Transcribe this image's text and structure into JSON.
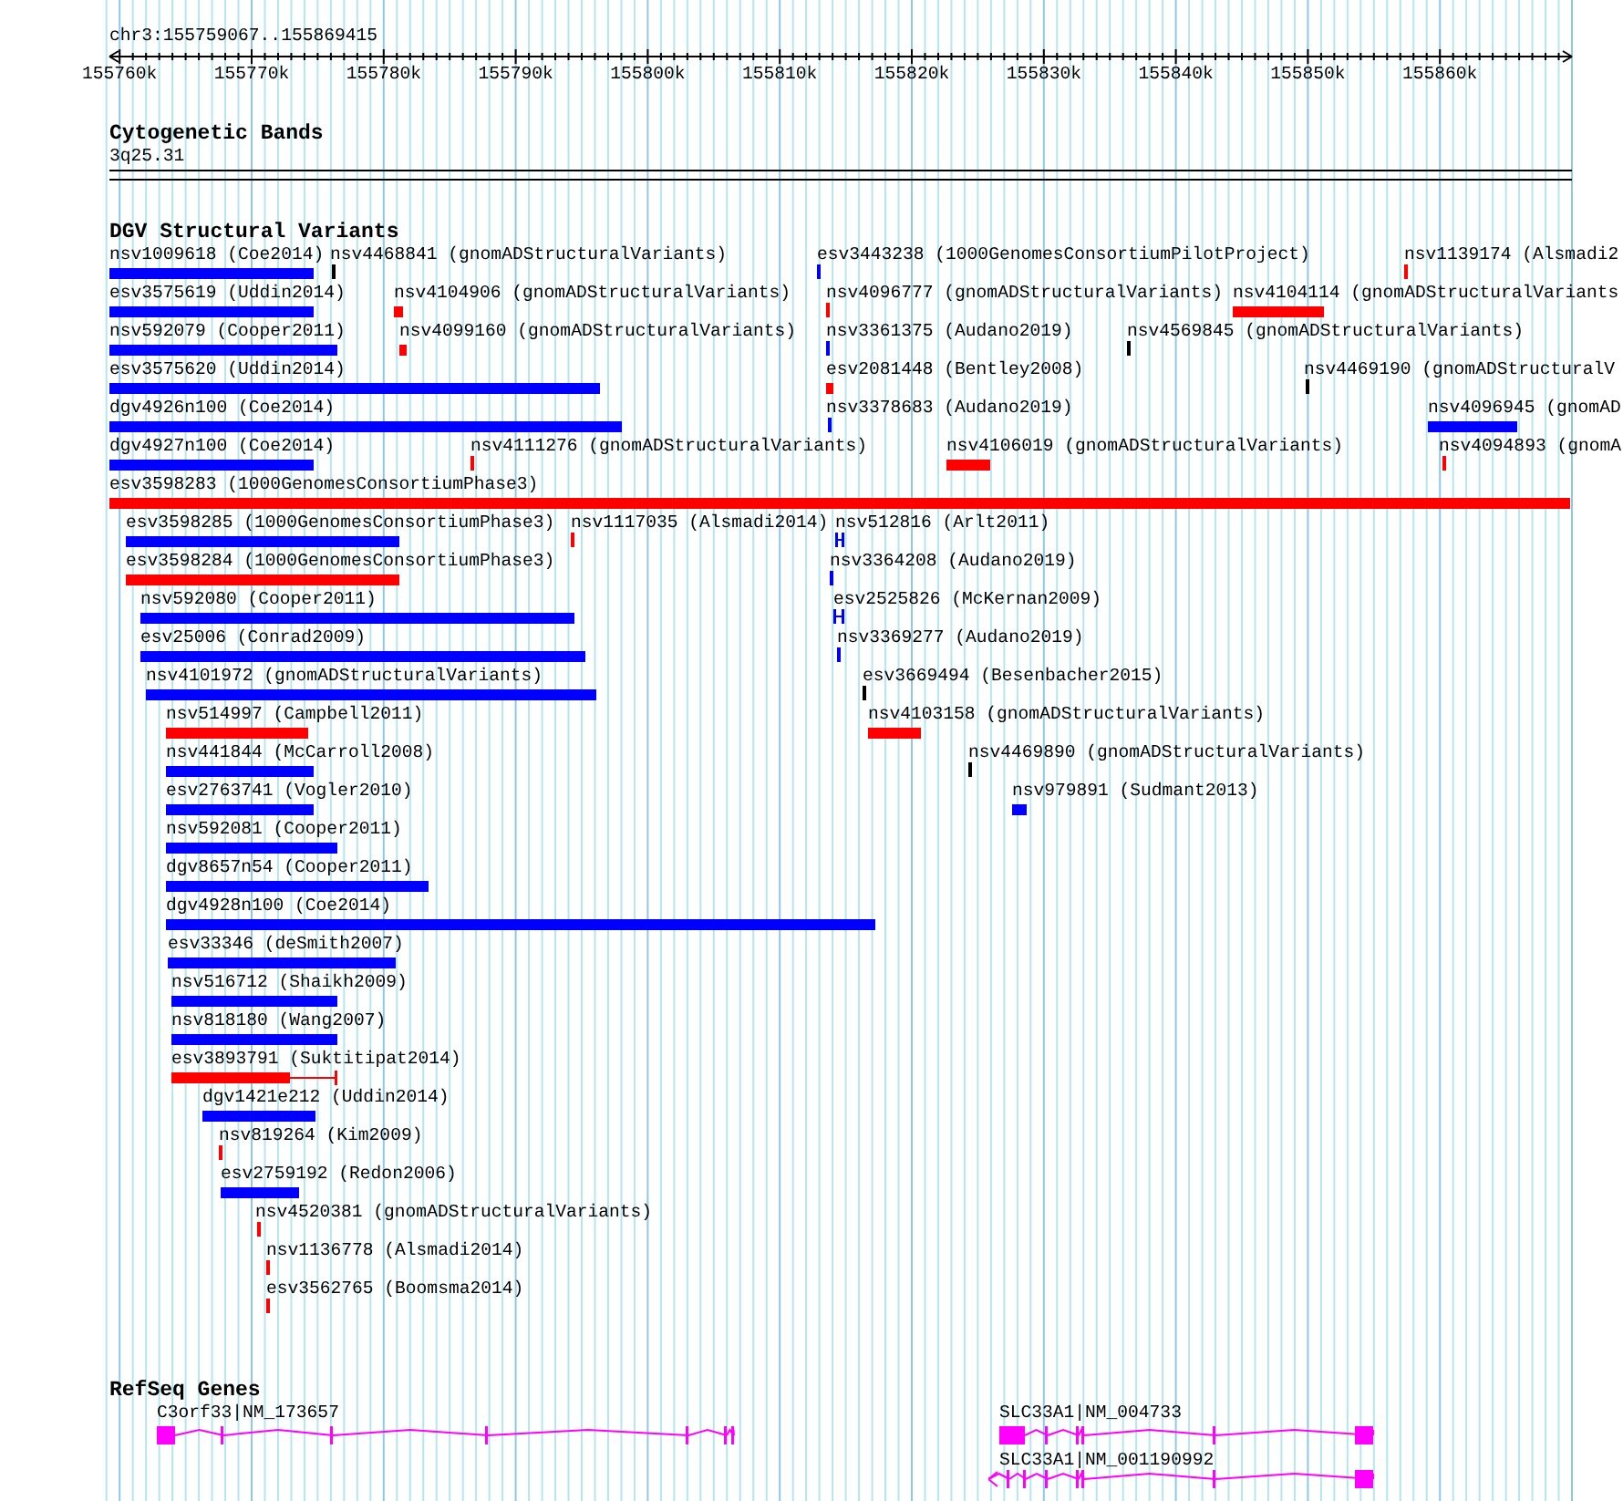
{
  "location": "chr3:155759067..155869415",
  "ruler": {
    "ticks": [
      "155760k",
      "155770k",
      "155780k",
      "155790k",
      "155800k",
      "155810k",
      "155820k",
      "155830k",
      "155840k",
      "155850k",
      "155860k"
    ]
  },
  "cytogenetic_bands": {
    "title": "Cytogenetic Bands",
    "band": "3q25.31"
  },
  "dgv": {
    "title": "DGV Structural Variants",
    "variants": [
      {
        "label": "nsv1009618 (Coe2014)",
        "color": "#0000ff"
      },
      {
        "label": "nsv4468841 (gnomADStructuralVariants)",
        "color": "#000000"
      },
      {
        "label": "esv3443238 (1000GenomesConsortiumPilotProject)",
        "color": "#0000ff"
      },
      {
        "label": "nsv1139174 (Alsmadi2",
        "color": "#ff0000"
      },
      {
        "label": "esv3575619 (Uddin2014)",
        "color": "#0000ff"
      },
      {
        "label": "nsv4104906 (gnomADStructuralVariants)",
        "color": "#ff0000"
      },
      {
        "label": "nsv4096777 (gnomADStructuralVariants)",
        "color": "#ff0000"
      },
      {
        "label": "nsv4104114 (gnomADStructuralVariants",
        "color": "#ff0000"
      },
      {
        "label": "nsv592079 (Cooper2011)",
        "color": "#0000ff"
      },
      {
        "label": "nsv4099160 (gnomADStructuralVariants)",
        "color": "#ff0000"
      },
      {
        "label": "nsv3361375 (Audano2019)",
        "color": "#0000ff"
      },
      {
        "label": "nsv4569845 (gnomADStructuralVariants)",
        "color": "#000000"
      },
      {
        "label": "esv3575620 (Uddin2014)",
        "color": "#0000ff"
      },
      {
        "label": "esv2081448 (Bentley2008)",
        "color": "#ff0000"
      },
      {
        "label": "nsv4469190 (gnomADStructuralV",
        "color": "#000000"
      },
      {
        "label": "dgv4926n100 (Coe2014)",
        "color": "#0000ff"
      },
      {
        "label": "nsv3378683 (Audano2019)",
        "color": "#0000ff"
      },
      {
        "label": "nsv4096945 (gnomAD",
        "color": "#0000ff"
      },
      {
        "label": "dgv4927n100 (Coe2014)",
        "color": "#0000ff"
      },
      {
        "label": "nsv4111276 (gnomADStructuralVariants)",
        "color": "#ff0000"
      },
      {
        "label": "nsv4106019 (gnomADStructuralVariants)",
        "color": "#ff0000"
      },
      {
        "label": "nsv4094893 (gnomA",
        "color": "#ff0000"
      },
      {
        "label": "esv3598283 (1000GenomesConsortiumPhase3)",
        "color": "#ff0000"
      },
      {
        "label": "esv3598285 (1000GenomesConsortiumPhase3)",
        "color": "#0000ff"
      },
      {
        "label": "nsv1117035 (Alsmadi2014)",
        "color": "#ff0000"
      },
      {
        "label": "nsv512816 (Arlt2011)",
        "color": "#0000ff"
      },
      {
        "label": "esv3598284 (1000GenomesConsortiumPhase3)",
        "color": "#ff0000"
      },
      {
        "label": "nsv3364208 (Audano2019)",
        "color": "#0000ff"
      },
      {
        "label": "nsv592080 (Cooper2011)",
        "color": "#0000ff"
      },
      {
        "label": "esv2525826 (McKernan2009)",
        "color": "#0000ff"
      },
      {
        "label": "esv25006 (Conrad2009)",
        "color": "#0000ff"
      },
      {
        "label": "nsv3369277 (Audano2019)",
        "color": "#0000ff"
      },
      {
        "label": "nsv4101972 (gnomADStructuralVariants)",
        "color": "#0000ff"
      },
      {
        "label": "esv3669494 (Besenbacher2015)",
        "color": "#000000"
      },
      {
        "label": "nsv514997 (Campbell2011)",
        "color": "#ff0000"
      },
      {
        "label": "nsv4103158 (gnomADStructuralVariants)",
        "color": "#ff0000"
      },
      {
        "label": "nsv441844 (McCarroll2008)",
        "color": "#0000ff"
      },
      {
        "label": "nsv4469890 (gnomADStructuralVariants)",
        "color": "#000000"
      },
      {
        "label": "esv2763741 (Vogler2010)",
        "color": "#0000ff"
      },
      {
        "label": "nsv979891 (Sudmant2013)",
        "color": "#0000ff"
      },
      {
        "label": "nsv592081 (Cooper2011)",
        "color": "#0000ff"
      },
      {
        "label": "dgv8657n54 (Cooper2011)",
        "color": "#0000ff"
      },
      {
        "label": "dgv4928n100 (Coe2014)",
        "color": "#0000ff"
      },
      {
        "label": "esv33346 (deSmith2007)",
        "color": "#0000ff"
      },
      {
        "label": "nsv516712 (Shaikh2009)",
        "color": "#0000ff"
      },
      {
        "label": "nsv818180 (Wang2007)",
        "color": "#0000ff"
      },
      {
        "label": "esv3893791 (Suktitipat2014)",
        "color": "#ff0000"
      },
      {
        "label": "dgv1421e212 (Uddin2014)",
        "color": "#0000ff"
      },
      {
        "label": "nsv819264 (Kim2009)",
        "color": "#ff0000"
      },
      {
        "label": "esv2759192 (Redon2006)",
        "color": "#0000ff"
      },
      {
        "label": "nsv4520381 (gnomADStructuralVariants)",
        "color": "#ff0000"
      },
      {
        "label": "nsv1136778 (Alsmadi2014)",
        "color": "#ff0000"
      },
      {
        "label": "esv3562765 (Boomsma2014)",
        "color": "#ff0000"
      }
    ]
  },
  "refseq_genes": {
    "title": "RefSeq Genes",
    "genes": [
      {
        "label": "C3orf33|NM_173657"
      },
      {
        "label": "SLC33A1|NM_004733"
      },
      {
        "label": "SLC33A1|NM_001190992"
      }
    ]
  }
}
